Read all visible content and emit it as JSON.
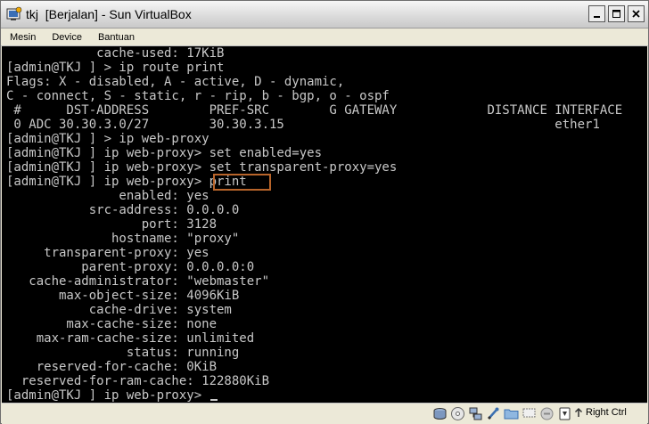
{
  "window": {
    "title": "tkj  [Berjalan] - Sun VirtualBox"
  },
  "menu": {
    "items": [
      "Mesin",
      "Device",
      "Bantuan"
    ]
  },
  "terminal": {
    "lines": [
      "            cache-used: 17KiB",
      "[admin@TKJ ] > ip route print",
      "Flags: X - disabled, A - active, D - dynamic,",
      "C - connect, S - static, r - rip, b - bgp, o - ospf",
      " #      DST-ADDRESS        PREF-SRC        G GATEWAY            DISTANCE INTERFACE",
      " 0 ADC 30.30.3.0/27        30.30.3.15                                    ether1",
      "[admin@TKJ ] > ip web-proxy",
      "[admin@TKJ ] ip web-proxy> set enabled=yes",
      "[admin@TKJ ] ip web-proxy> set transparent-proxy=yes",
      "[admin@TKJ ] ip web-proxy> print",
      "               enabled: yes",
      "           src-address: 0.0.0.0",
      "                  port: 3128",
      "              hostname: \"proxy\"",
      "     transparent-proxy: yes",
      "          parent-proxy: 0.0.0.0:0",
      "   cache-administrator: \"webmaster\"",
      "       max-object-size: 4096KiB",
      "           cache-drive: system",
      "        max-cache-size: none",
      "    max-ram-cache-size: unlimited",
      "                status: running",
      "    reserved-for-cache: 0KiB",
      "  reserved-for-ram-cache: 122880KiB",
      "[admin@TKJ ] ip web-proxy> "
    ]
  },
  "statusbar": {
    "host_key_label": "Right Ctrl"
  },
  "colors": {
    "terminal_bg": "#000000",
    "terminal_fg": "#c8c8c8",
    "highlight_border": "#b8642a"
  }
}
